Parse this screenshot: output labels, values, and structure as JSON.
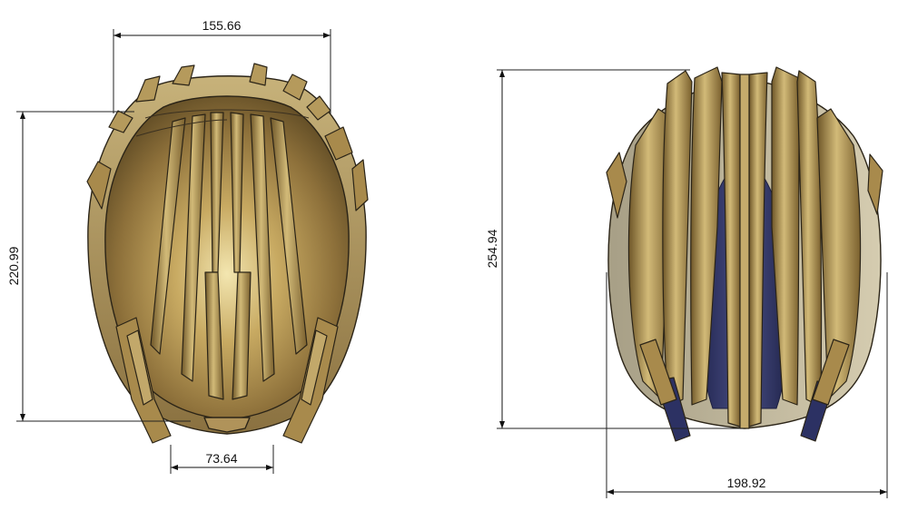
{
  "dimensions": {
    "top_view_width": "155.66",
    "top_view_height": "220.99",
    "top_view_opening": "73.64",
    "front_view_height": "254.94",
    "front_view_width": "198.92"
  },
  "colors": {
    "background": "#ffffff",
    "gold_light": "#d6c48a",
    "gold_mid": "#a88a4c",
    "gold_dark": "#5e4a24",
    "navy": "#2c3163",
    "line": "#111111"
  }
}
